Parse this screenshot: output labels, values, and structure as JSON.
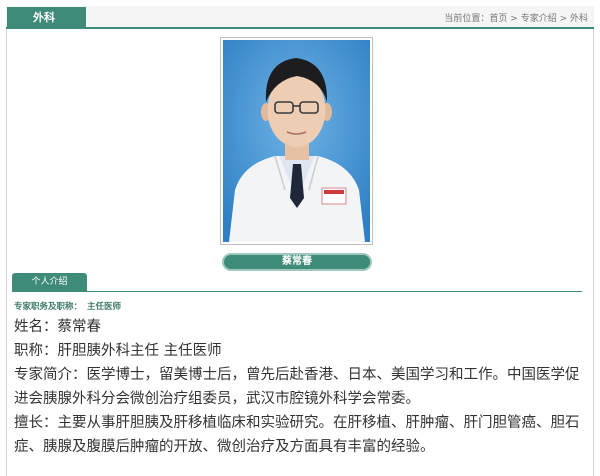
{
  "header": {
    "section_tab": "外科",
    "breadcrumb": {
      "prefix": "当前位置：",
      "home": "首页",
      "sep1": " > ",
      "experts": "专家介绍",
      "sep2": " > ",
      "current": "外科"
    }
  },
  "profile": {
    "name_pill": "蔡常春",
    "tab_label": "个人介绍",
    "position_label": "专家职务及职称：",
    "position_value": "主任医师",
    "lines": [
      "姓名：蔡常春",
      "职称：肝胆胰外科主任 主任医师",
      "专家简介：医学博士，留美博士后，曾先后赴香港、日本、美国学习和工作。中国医学促进会胰腺外科分会微创治疗组委员，武汉市腔镜外科学会常委。",
      "擅长：主要从事肝胆胰及肝移植临床和实验研究。在肝移植、肝肿瘤、肝门胆管癌、胆石症、胰腺及腹膜后肿瘤的开放、微创治疗及方面具有丰富的经验。"
    ]
  },
  "colors": {
    "accent": "#3f8b7a",
    "photo_background": "#3a8fd0",
    "text": "#333333"
  }
}
